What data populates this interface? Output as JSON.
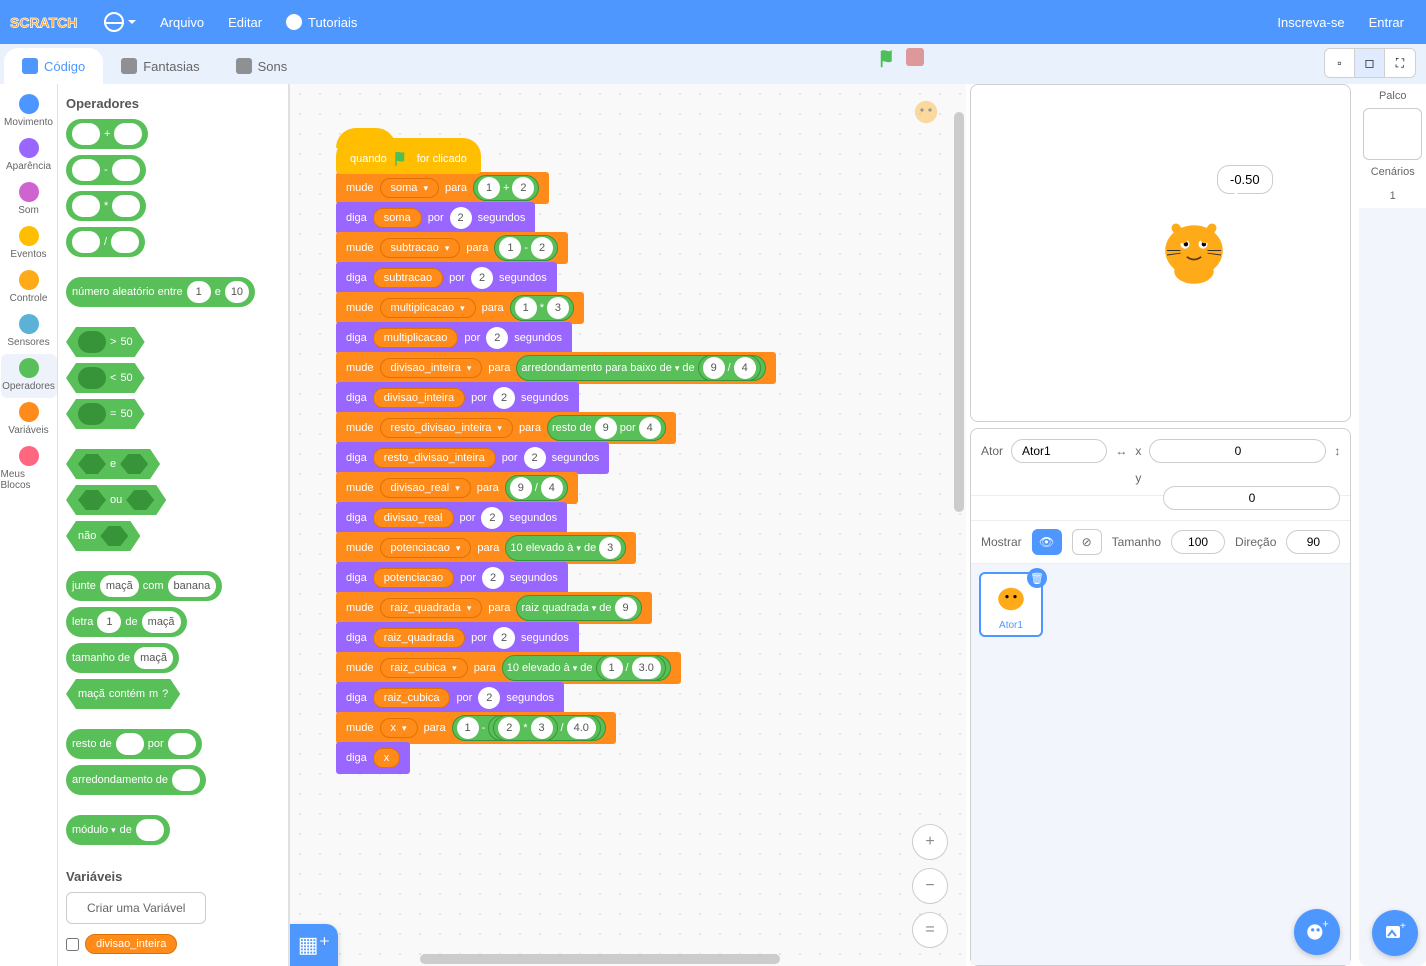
{
  "menu": {
    "file": "Arquivo",
    "edit": "Editar",
    "tutorials": "Tutoriais",
    "signup": "Inscreva-se",
    "signin": "Entrar"
  },
  "tabs": {
    "code": "Código",
    "costumes": "Fantasias",
    "sounds": "Sons"
  },
  "categories": [
    {
      "name": "Movimento",
      "color": "#4c97ff"
    },
    {
      "name": "Aparência",
      "color": "#9966ff"
    },
    {
      "name": "Som",
      "color": "#cf63cf"
    },
    {
      "name": "Eventos",
      "color": "#ffbf00"
    },
    {
      "name": "Controle",
      "color": "#ffab19"
    },
    {
      "name": "Sensores",
      "color": "#5cb1d6"
    },
    {
      "name": "Operadores",
      "color": "#59c059"
    },
    {
      "name": "Variáveis",
      "color": "#ff8c1a"
    },
    {
      "name": "Meus Blocos",
      "color": "#ff6680"
    }
  ],
  "palette": {
    "heading": "Operadores",
    "random": {
      "label": "número aleatório entre",
      "a": "1",
      "mid": "e",
      "b": "10"
    },
    "cmp": "50",
    "bool": {
      "and": "e",
      "or": "ou",
      "not": "não"
    },
    "join": {
      "label": "junte",
      "a": "maçã",
      "mid": "com",
      "b": "banana"
    },
    "letter": {
      "label": "letra",
      "n": "1",
      "of": "de",
      "s": "maçã"
    },
    "length": {
      "label": "tamanho de",
      "s": "maçã"
    },
    "contains": {
      "a": "maçã",
      "mid": "contém",
      "b": "m",
      "q": "?"
    },
    "mod": {
      "label": "resto de",
      "mid": "por"
    },
    "round": {
      "label": "arredondamento de"
    },
    "mathop": {
      "label": "módulo",
      "of": "de"
    },
    "varheading": "Variáveis",
    "makevar": "Criar uma Variável",
    "varname": "divisao_inteira"
  },
  "script": {
    "hat": {
      "when": "quando",
      "clicked": "for clicado"
    },
    "set": "mude",
    "to": "para",
    "say": "diga",
    "for": "por",
    "seconds": "segundos",
    "of": "de",
    "vars": {
      "soma": "soma",
      "subtracao": "subtracao",
      "multiplicacao": "multiplicacao",
      "divisao_inteira": "divisao_inteira",
      "resto_divisao_inteira": "resto_divisao_inteira",
      "divisao_real": "divisao_real",
      "potenciacao": "potenciacao",
      "raiz_quadrada": "raiz_quadrada",
      "raiz_cubica": "raiz_cubica",
      "x": "x"
    },
    "ops": {
      "floor": "arredondamento para baixo de",
      "mod": "resto de",
      "modpor": "por",
      "tenpow": "10 elevado à",
      "sqrt": "raiz quadrada"
    },
    "nums": {
      "n1": "1",
      "n2": "2",
      "n3": "3",
      "n4": "4",
      "n9": "9",
      "n4_0": "4.0",
      "n3_0": "3.0"
    }
  },
  "stage": {
    "bubble": "-0.50"
  },
  "sprite": {
    "labelSprite": "Ator",
    "name": "Ator1",
    "x": "x",
    "xv": "0",
    "y": "y",
    "yv": "0",
    "show": "Mostrar",
    "size": "Tamanho",
    "sizev": "100",
    "dir": "Direção",
    "dirv": "90"
  },
  "stagecol": {
    "label": "Palco",
    "backdrops": "Cenários",
    "count": "1"
  }
}
